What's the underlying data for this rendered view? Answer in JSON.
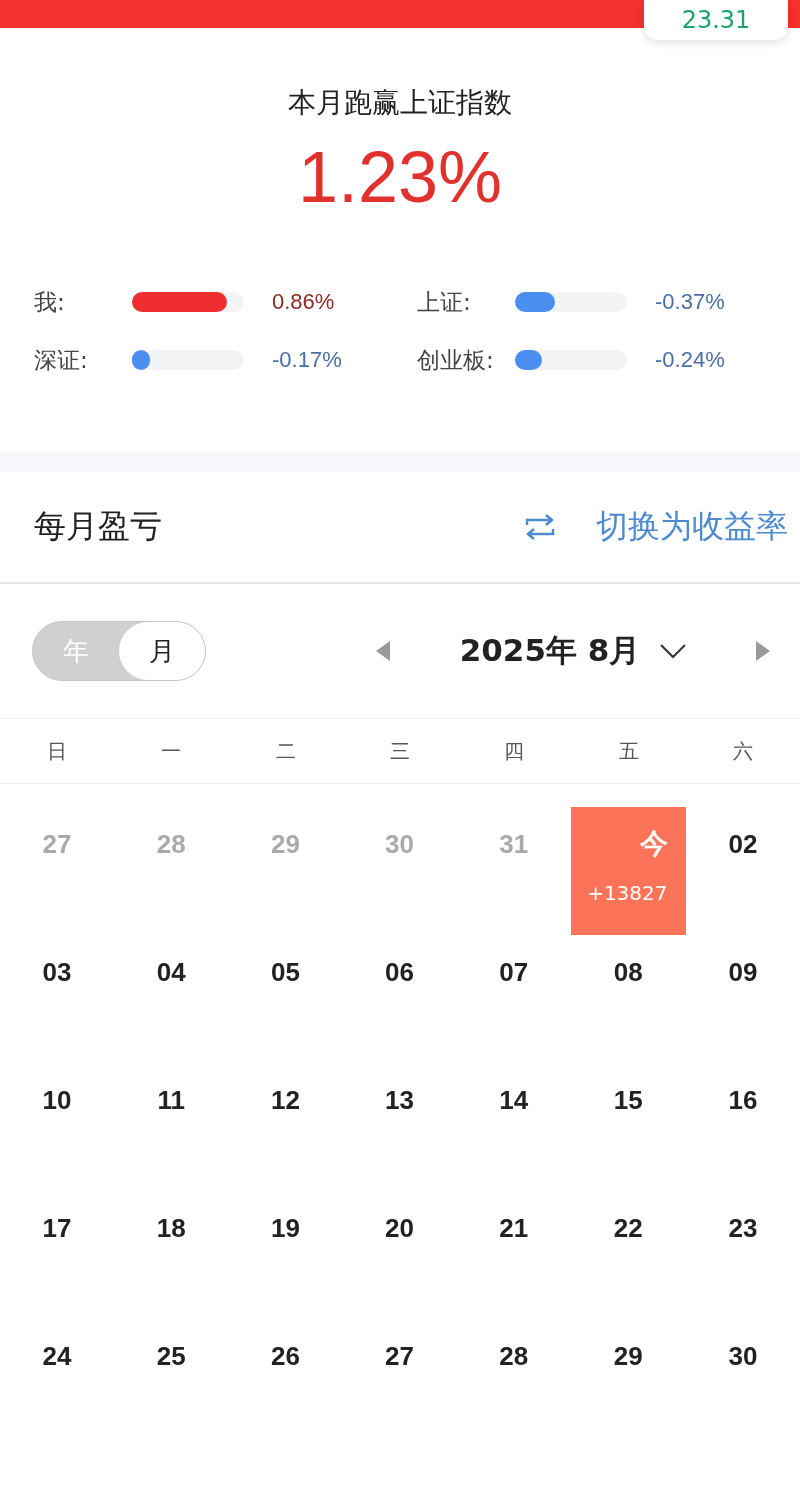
{
  "top_card": {
    "value": "23.31"
  },
  "summary": {
    "title": "本月跑赢上证指数",
    "value": "1.23%"
  },
  "comparisons": [
    {
      "label": "我:",
      "kind": "self",
      "level": 0.85,
      "reading": "0.86%"
    },
    {
      "label": "上证:",
      "kind": "index",
      "level": 0.36,
      "reading": "-0.37%"
    },
    {
      "label": "深证:",
      "kind": "index",
      "level": 0.13,
      "reading": "-0.17%"
    },
    {
      "label": "创业板:",
      "kind": "index",
      "level": 0.24,
      "reading": "-0.24%"
    }
  ],
  "section": {
    "title": "每月盈亏",
    "switch_label": "切换为收益率"
  },
  "view_toggle": [
    {
      "label": "年",
      "selected": false
    },
    {
      "label": "月",
      "selected": true
    }
  ],
  "month": {
    "label": "2025年 8月"
  },
  "weekdays": [
    "日",
    "一",
    "二",
    "三",
    "四",
    "五",
    "六"
  ],
  "days": [
    {
      "label": "27",
      "outside": true,
      "today": false
    },
    {
      "label": "28",
      "outside": true,
      "today": false
    },
    {
      "label": "29",
      "outside": true,
      "today": false
    },
    {
      "label": "30",
      "outside": true,
      "today": false
    },
    {
      "label": "31",
      "outside": true,
      "today": false
    },
    {
      "label": "今",
      "today": true,
      "amount": "+13827"
    },
    {
      "label": "02",
      "outside": false,
      "today": false
    },
    {
      "label": "03",
      "outside": false,
      "today": false
    },
    {
      "label": "04",
      "outside": false,
      "today": false
    },
    {
      "label": "05",
      "outside": false,
      "today": false
    },
    {
      "label": "06",
      "outside": false,
      "today": false
    },
    {
      "label": "07",
      "outside": false,
      "today": false
    },
    {
      "label": "08",
      "outside": false,
      "today": false
    },
    {
      "label": "09",
      "outside": false,
      "today": false
    },
    {
      "label": "10",
      "outside": false,
      "today": false
    },
    {
      "label": "11",
      "outside": false,
      "today": false
    },
    {
      "label": "12",
      "outside": false,
      "today": false
    },
    {
      "label": "13",
      "outside": false,
      "today": false
    },
    {
      "label": "14",
      "outside": false,
      "today": false
    },
    {
      "label": "15",
      "outside": false,
      "today": false
    },
    {
      "label": "16",
      "outside": false,
      "today": false
    },
    {
      "label": "17",
      "outside": false,
      "today": false
    },
    {
      "label": "18",
      "outside": false,
      "today": false
    },
    {
      "label": "19",
      "outside": false,
      "today": false
    },
    {
      "label": "20",
      "outside": false,
      "today": false
    },
    {
      "label": "21",
      "outside": false,
      "today": false
    },
    {
      "label": "22",
      "outside": false,
      "today": false
    },
    {
      "label": "23",
      "outside": false,
      "today": false
    },
    {
      "label": "24",
      "outside": false,
      "today": false
    },
    {
      "label": "25",
      "outside": false,
      "today": false
    },
    {
      "label": "26",
      "outside": false,
      "today": false
    },
    {
      "label": "27",
      "outside": false,
      "today": false
    },
    {
      "label": "28",
      "outside": false,
      "today": false
    },
    {
      "label": "29",
      "outside": false,
      "today": false
    },
    {
      "label": "30",
      "outside": false,
      "today": false
    }
  ]
}
